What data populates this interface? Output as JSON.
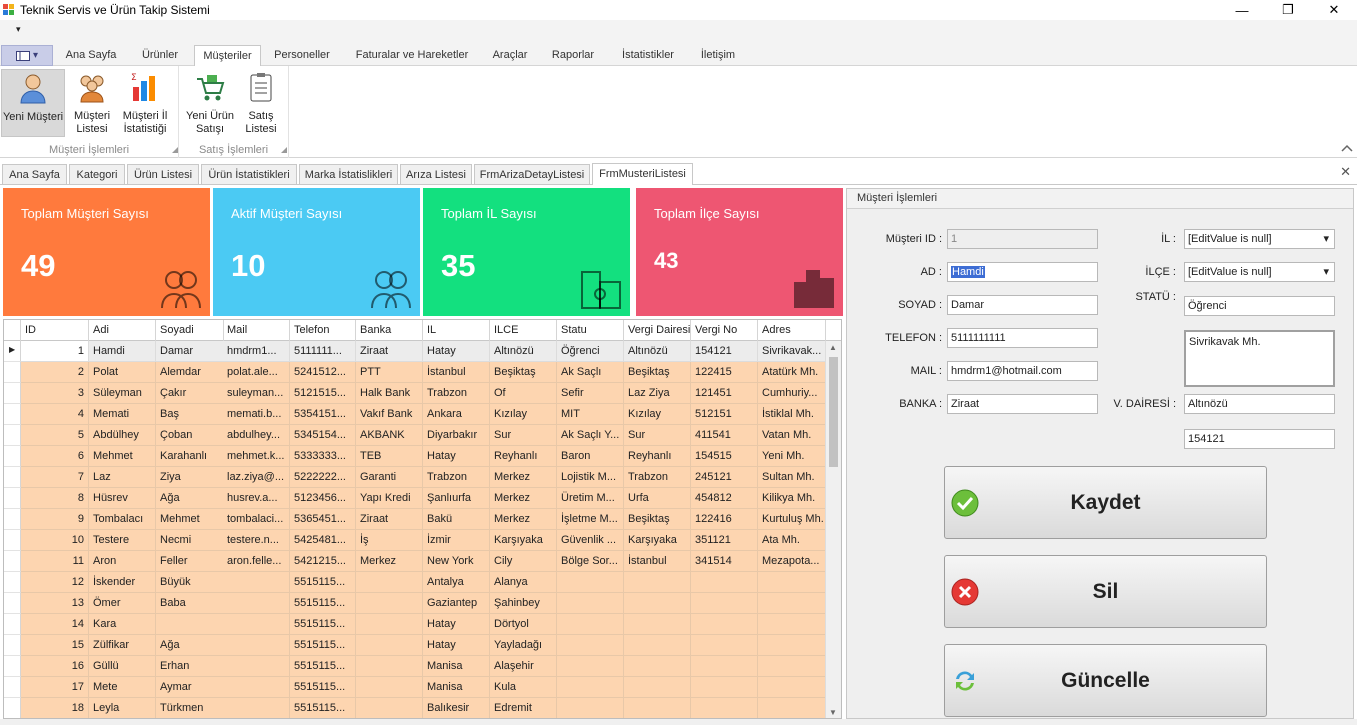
{
  "window": {
    "title": "Teknik Servis ve Ürün Takip Sistemi"
  },
  "qat": {
    "arrow": "▾"
  },
  "ribbon": {
    "tabs": [
      {
        "label": "Ana Sayfa",
        "name": "ribbon-tab-ana-sayfa"
      },
      {
        "label": "Ürünler",
        "name": "ribbon-tab-urunler"
      },
      {
        "label": "Müşteriler",
        "name": "ribbon-tab-musteriler",
        "active": true
      },
      {
        "label": "Personeller",
        "name": "ribbon-tab-personeller"
      },
      {
        "label": "Faturalar ve Hareketler",
        "name": "ribbon-tab-faturalar"
      },
      {
        "label": "Araçlar",
        "name": "ribbon-tab-araclar"
      },
      {
        "label": "Raporlar",
        "name": "ribbon-tab-raporlar"
      },
      {
        "label": "İstatistikler",
        "name": "ribbon-tab-istatistikler"
      },
      {
        "label": "İletişim",
        "name": "ribbon-tab-iletisim"
      }
    ],
    "groups": {
      "musteri": {
        "label": "Müşteri İşlemleri",
        "buttons": {
          "yeni": "Yeni Müşteri",
          "liste": "Müşteri Listesi",
          "istatistik": "Müşteri İl İstatistiği"
        }
      },
      "satis": {
        "label": "Satış İşlemleri",
        "buttons": {
          "yeni": "Yeni Ürün Satışı",
          "liste": "Satış Listesi"
        }
      }
    }
  },
  "doc_tabs": [
    "Ana Sayfa",
    "Kategori",
    "Ürün Listesi",
    "Ürün İstatistikleri",
    "Marka İstatislikleri",
    "Arıza Listesi",
    "FrmArizaDetayListesi",
    "FrmMusteriListesi"
  ],
  "tiles": [
    {
      "label": "Toplam Müşteri Sayısı",
      "value": "49",
      "color": "#ff7a3d"
    },
    {
      "label": "Aktif Müşteri Sayısı",
      "value": "10",
      "color": "#4bcaf3"
    },
    {
      "label": "Toplam İL Sayısı",
      "value": "35",
      "color": "#13e07f"
    },
    {
      "label": "Toplam İlçe Sayısı",
      "value": "43",
      "color": "#ee5672"
    }
  ],
  "grid": {
    "columns": [
      "ID",
      "Adi",
      "Soyadi",
      "Mail",
      "Telefon",
      "Banka",
      "IL",
      "ILCE",
      "Statu",
      "Vergi Dairesi",
      "Vergi No",
      "Adres"
    ],
    "rows": [
      [
        "1",
        "Hamdi",
        "Damar",
        "hmdrm1...",
        "5111111...",
        "Ziraat",
        "Hatay",
        "Altınözü",
        "Öğrenci",
        "Altınözü",
        "154121",
        "Sivrikavak..."
      ],
      [
        "2",
        "Polat",
        "Alemdar",
        "polat.ale...",
        "5241512...",
        "PTT",
        "İstanbul",
        "Beşiktaş",
        "Ak Saçlı",
        "Beşiktaş",
        "122415",
        "Atatürk Mh."
      ],
      [
        "3",
        "Süleyman",
        "Çakır",
        "suleyman...",
        "5121515...",
        "Halk Bank",
        "Trabzon",
        "Of",
        "Sefir",
        "Laz Ziya",
        "121451",
        "Cumhuriy..."
      ],
      [
        "4",
        "Memati",
        "Baş",
        "memati.b...",
        "5354151...",
        "Vakıf Bank",
        "Ankara",
        "Kızılay",
        "MIT",
        "Kızılay",
        "512151",
        "İstiklal Mh."
      ],
      [
        "5",
        "Abdülhey",
        "Çoban",
        "abdulhey...",
        "5345154...",
        "AKBANK",
        "Diyarbakır",
        "Sur",
        "Ak Saçlı Y...",
        "Sur",
        "411541",
        "Vatan Mh."
      ],
      [
        "6",
        "Mehmet",
        "Karahanlı",
        "mehmet.k...",
        "5333333...",
        "TEB",
        "Hatay",
        "Reyhanlı",
        "Baron",
        "Reyhanlı",
        "154515",
        "Yeni Mh."
      ],
      [
        "7",
        "Laz",
        "Ziya",
        "laz.ziya@...",
        "5222222...",
        "Garanti",
        "Trabzon",
        "Merkez",
        "Lojistik M...",
        "Trabzon",
        "245121",
        "Sultan Mh."
      ],
      [
        "8",
        "Hüsrev",
        "Ağa",
        "husrev.a...",
        "5123456...",
        "Yapı Kredi",
        "Şanlıurfa",
        "Merkez",
        "Üretim M...",
        "Urfa",
        "454812",
        "Kilikya Mh."
      ],
      [
        "9",
        "Tombalacı",
        "Mehmet",
        "tombalaci...",
        "5365451...",
        "Ziraat",
        "Bakü",
        "Merkez",
        "İşletme M...",
        "Beşiktaş",
        "122416",
        "Kurtuluş Mh."
      ],
      [
        "10",
        "Testere",
        "Necmi",
        "testere.n...",
        "5425481...",
        "İş",
        "İzmir",
        "Karşıyaka",
        "Güvenlik ...",
        "Karşıyaka",
        "351121",
        "Ata Mh."
      ],
      [
        "11",
        "Aron",
        "Feller",
        "aron.felle...",
        "5421215...",
        "Merkez",
        "New York",
        "Cily",
        "Bölge Sor...",
        "İstanbul",
        "341514",
        "Mezapota..."
      ],
      [
        "12",
        "İskender",
        "Büyük",
        "",
        "5515115...",
        "",
        "Antalya",
        "Alanya",
        "",
        "",
        "",
        ""
      ],
      [
        "13",
        "Ömer",
        "Baba",
        "",
        "5515115...",
        "",
        "Gaziantep",
        "Şahinbey",
        "",
        "",
        "",
        ""
      ],
      [
        "14",
        "Kara",
        "",
        "",
        "5515115...",
        "",
        "Hatay",
        "Dörtyol",
        "",
        "",
        "",
        ""
      ],
      [
        "15",
        "Zülfikar",
        "Ağa",
        "",
        "5515115...",
        "",
        "Hatay",
        "Yayladağı",
        "",
        "",
        "",
        ""
      ],
      [
        "16",
        "Güllü",
        "Erhan",
        "",
        "5515115...",
        "",
        "Manisa",
        "Alaşehir",
        "",
        "",
        "",
        ""
      ],
      [
        "17",
        "Mete",
        "Aymar",
        "",
        "5515115...",
        "",
        "Manisa",
        "Kula",
        "",
        "",
        "",
        ""
      ],
      [
        "18",
        "Leyla",
        "Türkmen",
        "",
        "5515115...",
        "",
        "Balıkesir",
        "Edremit",
        "",
        "",
        "",
        ""
      ]
    ]
  },
  "form": {
    "title": "Müşteri İşlemleri",
    "labels": {
      "id": "Müşteri ID :",
      "ad": "AD :",
      "soyad": "SOYAD :",
      "telefon": "TELEFON :",
      "mail": "MAIL :",
      "banka": "BANKA :",
      "il": "İL :",
      "ilce": "İLÇE :",
      "statu": "STATÜ :",
      "vdairesi": "V. DAİRESİ :"
    },
    "values": {
      "id": "1",
      "ad": "Hamdi",
      "soyad": "Damar",
      "telefon": "5111111111",
      "mail": "hmdrm1@hotmail.com",
      "banka": "Ziraat",
      "il": "[EditValue is null]",
      "ilce": "[EditValue is null]",
      "statu": "Öğrenci",
      "adres": "Sivrikavak Mh.",
      "vdairesi": "Altınözü",
      "vergino": "154121"
    },
    "buttons": {
      "kaydet": "Kaydet",
      "sil": "Sil",
      "guncelle": "Güncelle"
    }
  }
}
